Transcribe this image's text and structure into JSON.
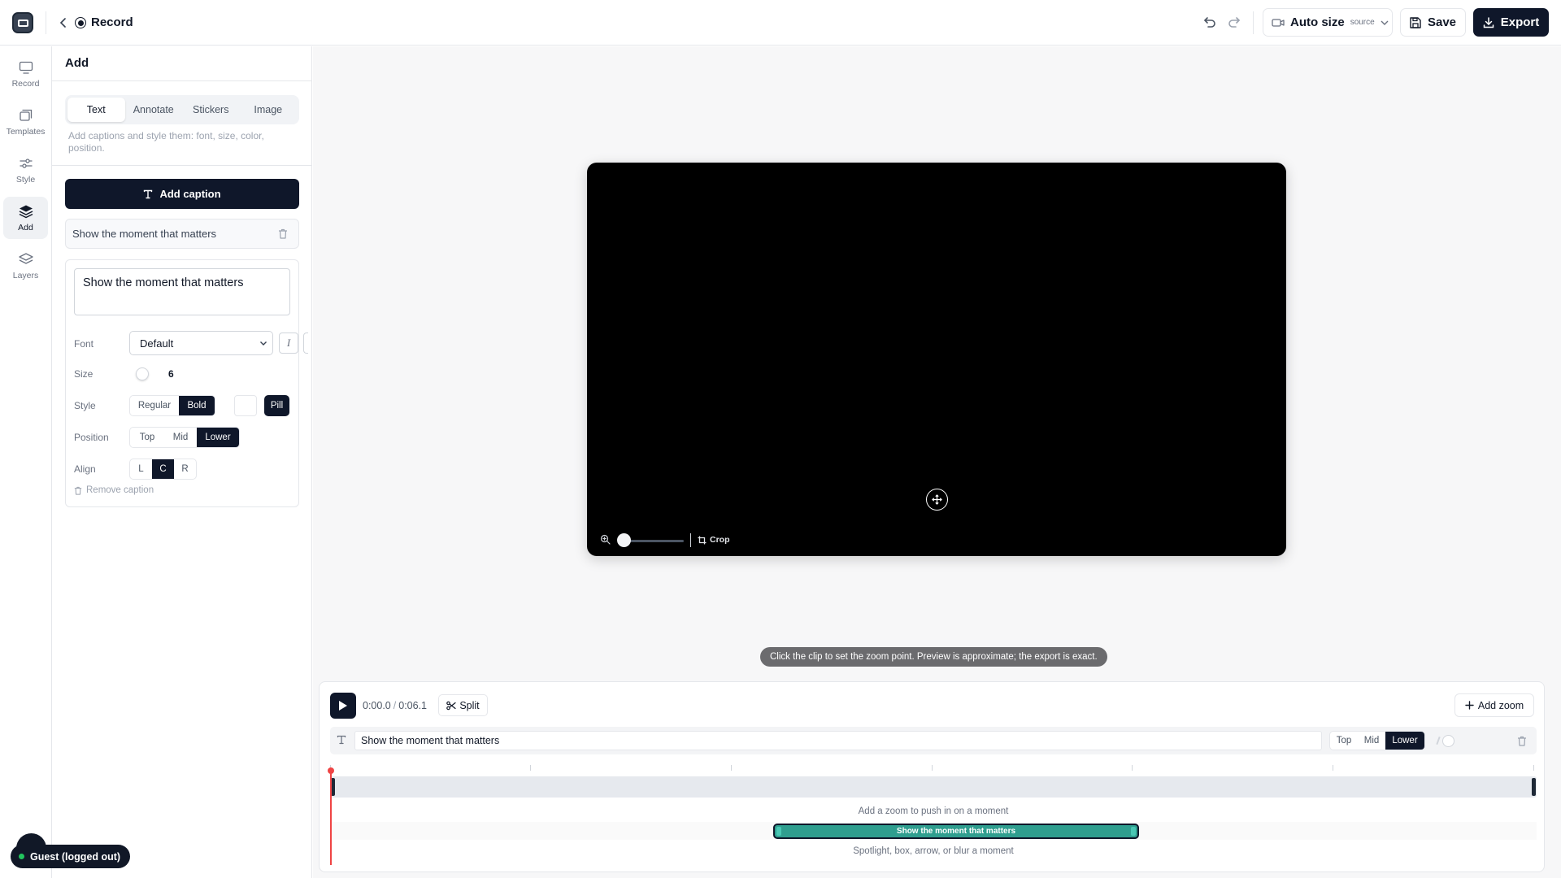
{
  "header": {
    "title": "Record",
    "autosize_label": "Auto size",
    "autosize_sub": "source",
    "save_label": "Save",
    "export_label": "Export"
  },
  "rail": {
    "items": [
      {
        "label": "Record",
        "icon": "monitor-icon"
      },
      {
        "label": "Templates",
        "icon": "templates-icon"
      },
      {
        "label": "Style",
        "icon": "sliders-icon"
      },
      {
        "label": "Add",
        "icon": "layers-filled-icon",
        "active": true
      },
      {
        "label": "Layers",
        "icon": "layers-icon"
      }
    ]
  },
  "panel": {
    "title": "Add",
    "tabs": [
      "Text",
      "Annotate",
      "Stickers",
      "Image"
    ],
    "active_tab": "Text",
    "help": "Add captions and style them: font, size, color, position.",
    "add_caption_label": "Add caption",
    "caption_item": "Show the moment that matters",
    "editor": {
      "text": "Show the moment that matters",
      "font_label": "Font",
      "font_value": "Default",
      "size_label": "Size",
      "size_value": "6",
      "style_label": "Style",
      "style_options": [
        "Regular",
        "Bold"
      ],
      "style_selected": "Bold",
      "pill_label": "Pill",
      "position_label": "Position",
      "position_options": [
        "Top",
        "Mid",
        "Lower"
      ],
      "position_selected": "Lower",
      "align_label": "Align",
      "align_options": [
        "L",
        "C",
        "R"
      ],
      "align_selected": "C",
      "remove_label": "Remove caption"
    }
  },
  "preview": {
    "crop_label": "Crop",
    "hint": "Click the clip to set the zoom point. Preview is approximate; the export is exact."
  },
  "timeline": {
    "current_time": "0:00.0",
    "duration": "0:06.1",
    "split_label": "Split",
    "add_zoom_label": "Add zoom",
    "caption_text": "Show the moment that matters",
    "positions": [
      "Top",
      "Mid",
      "Lower"
    ],
    "position_selected": "Lower",
    "zoom_lane_hint": "Add a zoom to push in on a moment",
    "clip_label": "Show the moment that matters",
    "annotate_lane_hint": "Spotlight, box, arrow, or blur a moment"
  },
  "user": {
    "status": "Guest (logged out)"
  },
  "colors": {
    "accent": "#0f172a",
    "clip": "#2f9e8f",
    "playhead": "#ef4444",
    "status_online": "#22c55e"
  }
}
